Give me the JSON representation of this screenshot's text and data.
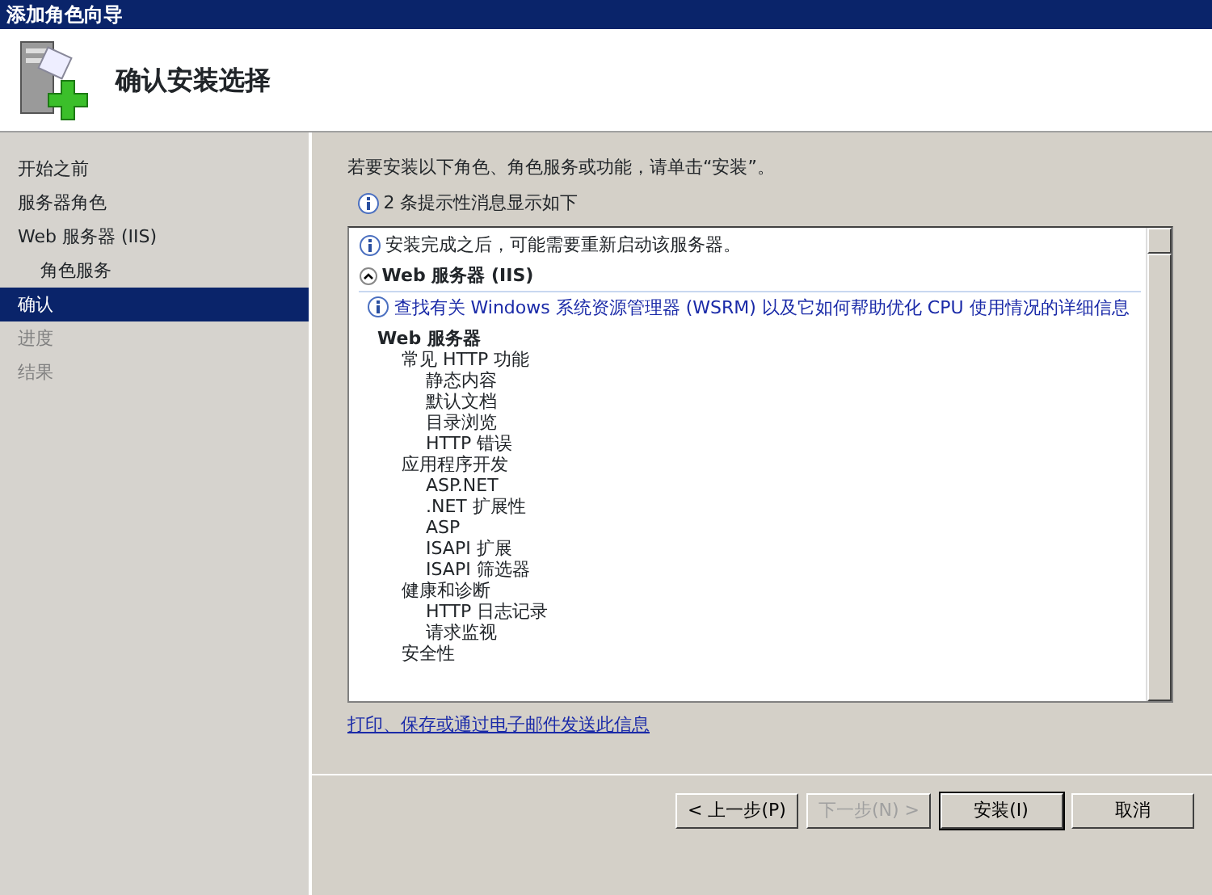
{
  "window": {
    "title": "添加角色向导"
  },
  "header": {
    "title": "确认安装选择"
  },
  "sidebar": {
    "items": [
      {
        "label": "开始之前",
        "selected": false,
        "disabled": false
      },
      {
        "label": "服务器角色",
        "selected": false,
        "disabled": false
      },
      {
        "label": "Web 服务器 (IIS)",
        "selected": false,
        "disabled": false,
        "children": [
          {
            "label": "角色服务",
            "selected": false,
            "disabled": false
          }
        ]
      },
      {
        "label": "确认",
        "selected": true,
        "disabled": false
      },
      {
        "label": "进度",
        "selected": false,
        "disabled": true
      },
      {
        "label": "结果",
        "selected": false,
        "disabled": true
      }
    ]
  },
  "intro": "若要安装以下角色、角色服务或功能，请单击“安装”。",
  "info_count": "2 条提示性消息显示如下",
  "details": {
    "message": "安装完成之后，可能需要重新启动该服务器。",
    "section": {
      "title": "Web 服务器 (IIS)",
      "expanded": true,
      "link": "查找有关 Windows 系统资源管理器 (WSRM) 以及它如何帮助优化 CPU 使用情况的详细信息",
      "tree": [
        {
          "label": "Web 服务器",
          "children": [
            {
              "label": "常见 HTTP 功能",
              "children": [
                {
                  "label": "静态内容"
                },
                {
                  "label": "默认文档"
                },
                {
                  "label": "目录浏览"
                },
                {
                  "label": "HTTP 错误"
                }
              ]
            },
            {
              "label": "应用程序开发",
              "children": [
                {
                  "label": "ASP.NET"
                },
                {
                  "label": ".NET 扩展性"
                },
                {
                  "label": "ASP"
                },
                {
                  "label": "ISAPI 扩展"
                },
                {
                  "label": "ISAPI 筛选器"
                }
              ]
            },
            {
              "label": "健康和诊断",
              "children": [
                {
                  "label": "HTTP 日志记录"
                },
                {
                  "label": "请求监视"
                }
              ]
            },
            {
              "label": "安全性"
            }
          ]
        }
      ]
    }
  },
  "print_link": "打印、保存或通过电子邮件发送此信息",
  "buttons": [
    {
      "label": "< 上一步(P)",
      "disabled": false,
      "kind": "normal"
    },
    {
      "label": "下一步(N) >",
      "disabled": true,
      "kind": "normal"
    },
    {
      "label": "安装(I)",
      "disabled": false,
      "kind": "default"
    },
    {
      "label": "取消",
      "disabled": false,
      "kind": "normal"
    }
  ]
}
